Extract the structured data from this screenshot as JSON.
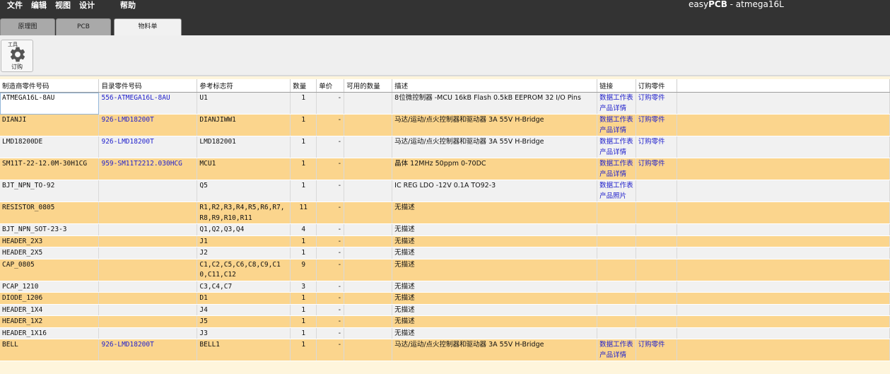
{
  "menu": [
    "文件",
    "编辑",
    "视图",
    "设计",
    "帮助"
  ],
  "title": {
    "prefix": "easy",
    "brand": "PCB",
    "suffix": " - atmega16L"
  },
  "tabs": [
    {
      "label": "原理图",
      "active": false
    },
    {
      "label": "PCB",
      "active": false
    },
    {
      "label": "物料单",
      "active": true
    }
  ],
  "toolbar": {
    "group_label": "工具",
    "order_label": "订购",
    "icon": "gear-icon"
  },
  "table": {
    "columns": [
      "制造商零件号码",
      "目录零件号码",
      "参考标志符",
      "数量",
      "单价",
      "可用的数量",
      "描述",
      "链接",
      "订购零件"
    ],
    "rows": [
      {
        "mfr": "ATMEGA16L-8AU",
        "cat": "556-ATMEGA16L-8AU",
        "ref": "U1",
        "qty": "1",
        "price": "-",
        "avail": "",
        "desc": "8位微控制器 -MCU 16kB Flash 0.5kB EEPROM 32 I/O Pins",
        "links": [
          "数据工作表",
          "产品详情"
        ],
        "order": "订购零件"
      },
      {
        "mfr": "DIANJI",
        "cat": "926-LMD18200T",
        "ref": "DIANJIWW1",
        "qty": "1",
        "price": "-",
        "avail": "",
        "desc": "马达/运动/点火控制器和驱动器 3A 55V H-Bridge",
        "links": [
          "数据工作表",
          "产品详情"
        ],
        "order": "订购零件"
      },
      {
        "mfr": "LMD18200DE",
        "cat": "926-LMD18200T",
        "ref": "LMD182001",
        "qty": "1",
        "price": "-",
        "avail": "",
        "desc": "马达/运动/点火控制器和驱动器 3A 55V H-Bridge",
        "links": [
          "数据工作表",
          "产品详情"
        ],
        "order": "订购零件"
      },
      {
        "mfr": "SM11T-22-12.0M-30H1CG",
        "cat": "959-SM11T2212.030HCG",
        "ref": "MCU1",
        "qty": "1",
        "price": "-",
        "avail": "",
        "desc": "晶体 12MHz 50ppm 0-70DC",
        "links": [
          "数据工作表",
          "产品详情"
        ],
        "order": "订购零件"
      },
      {
        "mfr": "BJT_NPN_TO-92",
        "cat": "",
        "ref": "Q5",
        "qty": "1",
        "price": "-",
        "avail": "",
        "desc": "IC REG LDO -12V 0.1A TO92-3",
        "links": [
          "数据工作表",
          "产品照片"
        ],
        "order": ""
      },
      {
        "mfr": "RESISTOR_0805",
        "cat": "",
        "ref": "R1,R2,R3,R4,R5,R6,R7,R8,R9,R10,R11",
        "qty": "11",
        "price": "-",
        "avail": "",
        "desc": "无描述",
        "links": [],
        "order": ""
      },
      {
        "mfr": "BJT_NPN_SOT-23-3",
        "cat": "",
        "ref": "Q1,Q2,Q3,Q4",
        "qty": "4",
        "price": "-",
        "avail": "",
        "desc": "无描述",
        "links": [],
        "order": ""
      },
      {
        "mfr": "HEADER_2X3",
        "cat": "",
        "ref": "J1",
        "qty": "1",
        "price": "-",
        "avail": "",
        "desc": "无描述",
        "links": [],
        "order": ""
      },
      {
        "mfr": "HEADER_2X5",
        "cat": "",
        "ref": "J2",
        "qty": "1",
        "price": "-",
        "avail": "",
        "desc": "无描述",
        "links": [],
        "order": ""
      },
      {
        "mfr": "CAP_0805",
        "cat": "",
        "ref": "C1,C2,C5,C6,C8,C9,C10,C11,C12",
        "qty": "9",
        "price": "-",
        "avail": "",
        "desc": "无描述",
        "links": [],
        "order": ""
      },
      {
        "mfr": "PCAP_1210",
        "cat": "",
        "ref": "C3,C4,C7",
        "qty": "3",
        "price": "-",
        "avail": "",
        "desc": "无描述",
        "links": [],
        "order": ""
      },
      {
        "mfr": "DIODE_1206",
        "cat": "",
        "ref": "D1",
        "qty": "1",
        "price": "-",
        "avail": "",
        "desc": "无描述",
        "links": [],
        "order": ""
      },
      {
        "mfr": "HEADER_1X4",
        "cat": "",
        "ref": "J4",
        "qty": "1",
        "price": "-",
        "avail": "",
        "desc": "无描述",
        "links": [],
        "order": ""
      },
      {
        "mfr": "HEADER_1X2",
        "cat": "",
        "ref": "J5",
        "qty": "1",
        "price": "-",
        "avail": "",
        "desc": "无描述",
        "links": [],
        "order": ""
      },
      {
        "mfr": "HEADER_1X16",
        "cat": "",
        "ref": "J3",
        "qty": "1",
        "price": "-",
        "avail": "",
        "desc": "无描述",
        "links": [],
        "order": ""
      },
      {
        "mfr": "BELL",
        "cat": "926-LMD18200T",
        "ref": "BELL1",
        "qty": "1",
        "price": "-",
        "avail": "",
        "desc": "马达/运动/点火控制器和驱动器 3A 55V H-Bridge",
        "links": [
          "数据工作表",
          "产品详情"
        ],
        "order": "订购零件"
      }
    ]
  },
  "colors": {
    "topbar": "#333333",
    "row_odd": "#f1f1f1",
    "row_even": "#fbd58d",
    "link": "#2222cc",
    "page_bg": "#fef5dc"
  }
}
